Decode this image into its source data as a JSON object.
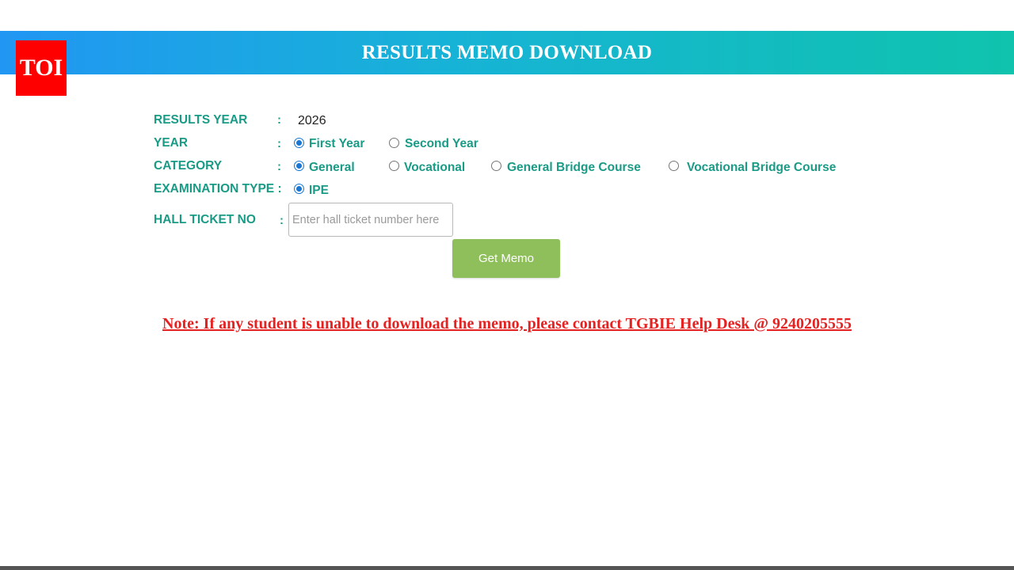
{
  "logo": {
    "text": "TOI",
    "color": "#ff0000"
  },
  "header": {
    "title": "RESULTS MEMO DOWNLOAD"
  },
  "form": {
    "colon": ":",
    "results_year": {
      "label": "RESULTS YEAR",
      "value": "2026"
    },
    "year": {
      "label": "YEAR",
      "options": [
        {
          "label": "First Year",
          "checked": true
        },
        {
          "label": "Second Year",
          "checked": false
        }
      ]
    },
    "category": {
      "label": "CATEGORY",
      "options": [
        {
          "label": "General",
          "checked": true
        },
        {
          "label": "Vocational",
          "checked": false
        },
        {
          "label": "General Bridge Course",
          "checked": false
        },
        {
          "label": "Vocational Bridge Course",
          "checked": false
        }
      ]
    },
    "exam_type": {
      "label": "EXAMINATION TYPE :",
      "options": [
        {
          "label": "IPE",
          "checked": true
        }
      ]
    },
    "hall_ticket": {
      "label": "HALL TICKET NO",
      "value": "",
      "placeholder": "Enter hall ticket number here"
    },
    "submit_label": "Get Memo"
  },
  "note": "Note: If any student is unable to download the memo, please contact TGBIE Help Desk @ 9240205555",
  "colors": {
    "accent_teal": "#1a9b86",
    "button_green": "#8fbf5a",
    "note_red": "#e52222"
  }
}
